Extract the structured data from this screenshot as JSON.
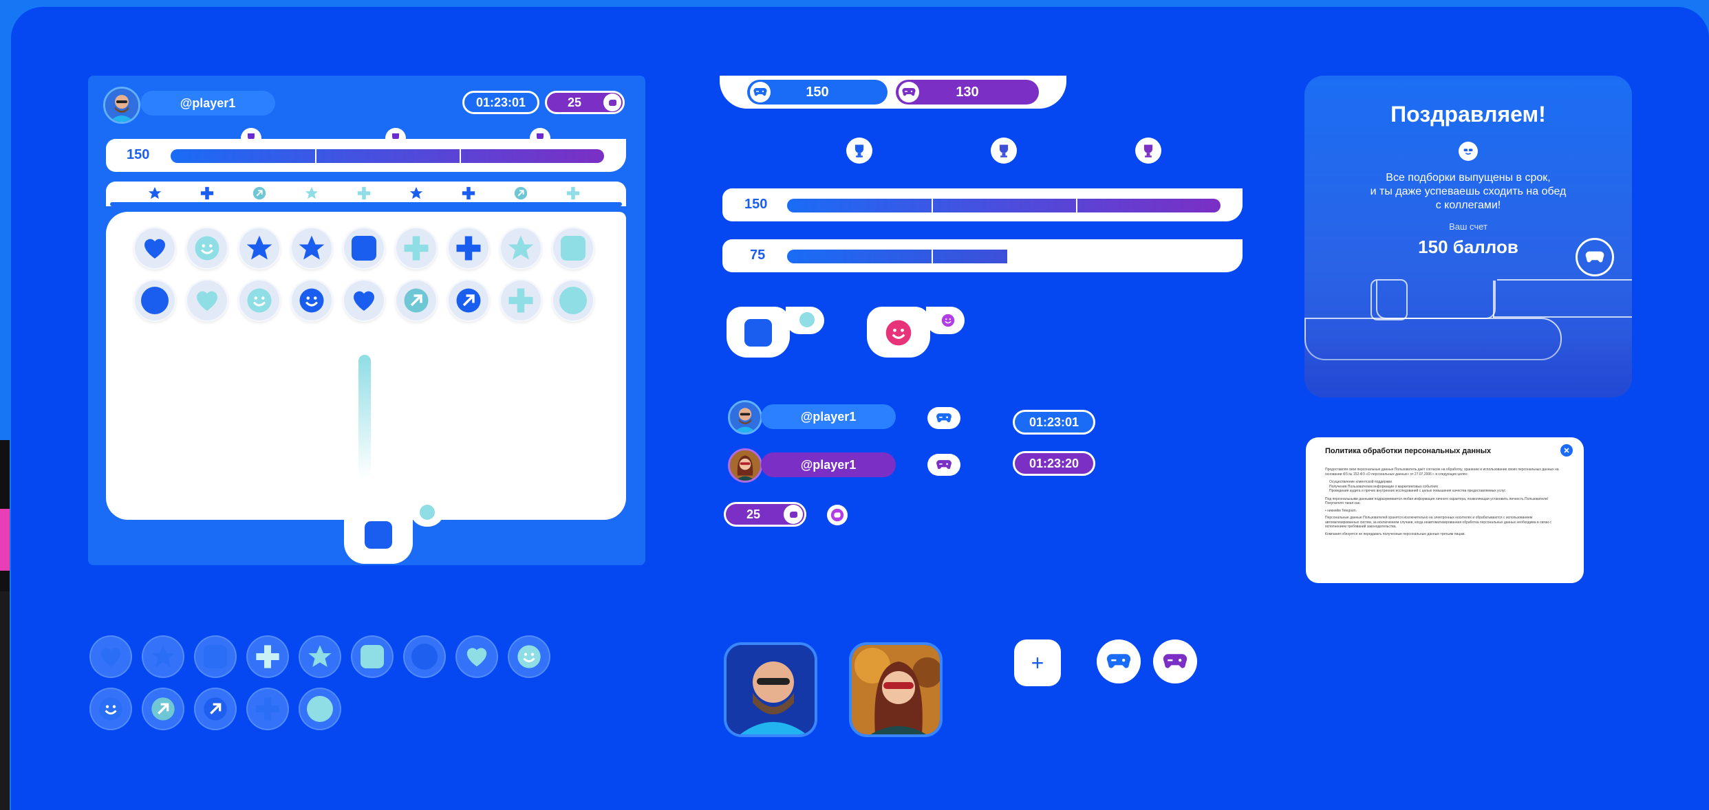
{
  "colors": {
    "bg": "#0548f2",
    "frame": "#1677f5",
    "accent_blue": "#1a6cf6",
    "accent_purple": "#7b2fc4",
    "teal": "#8fdde5",
    "white": "#ffffff",
    "pink": "#e8337a"
  },
  "game_panel": {
    "username": "@player1",
    "timer": "01:23:01",
    "points": "25",
    "score": "150"
  },
  "hud": {
    "player_a_score": "150",
    "player_b_score": "130",
    "bar1_score": "150",
    "bar2_score": "75",
    "bar1_fill": 1.0,
    "bar2_fill": 0.5
  },
  "players": [
    {
      "username": "@player1",
      "timer": "01:23:01"
    },
    {
      "username": "@player1",
      "timer": "01:23:20"
    }
  ],
  "points_badge": "25",
  "congrats_card": {
    "title": "Поздравляем!",
    "message_line1": "Все подборки выпущены в срок,",
    "message_line2": "и ты даже успеваешь сходить на обед",
    "message_line3": "с коллегами!",
    "score_label": "Ваш счет",
    "score_value": "150 баллов"
  },
  "policy_dialog": {
    "title": "Политика обработки персональных данных",
    "para1": "Предоставляя свои персональные данные Пользователь даёт согласие на обработку, хранение и использование своих персональных данных на основании ФЗ № 152-ФЗ «О персональных данных» от 27.07.2006 г. в следующих целях:",
    "items": [
      "Осуществление клиентской поддержки",
      "Получения Пользователем информации о маркетинговых событиях",
      "Проведения аудита и прочих внутренних исследований с целью повышения качества предоставляемых услуг."
    ],
    "para2": "Под персональными данными подразумевается любая информация личного характера, позволяющая установить личность Пользователя/Покупателя такая как:",
    "para3": "• никнейм Telegram.",
    "para4": "Персональные данные Пользователей хранятся исключительно на электронных носителях и обрабатываются с использованием автоматизированных систем, за исключением случаев, когда неавтоматизированная обработка персональных данных необходима в связи с исполнением требований законодательства.",
    "para5": "Компания обязуется не передавать полученные персональные данные третьим лицам."
  },
  "add_button_label": "+"
}
